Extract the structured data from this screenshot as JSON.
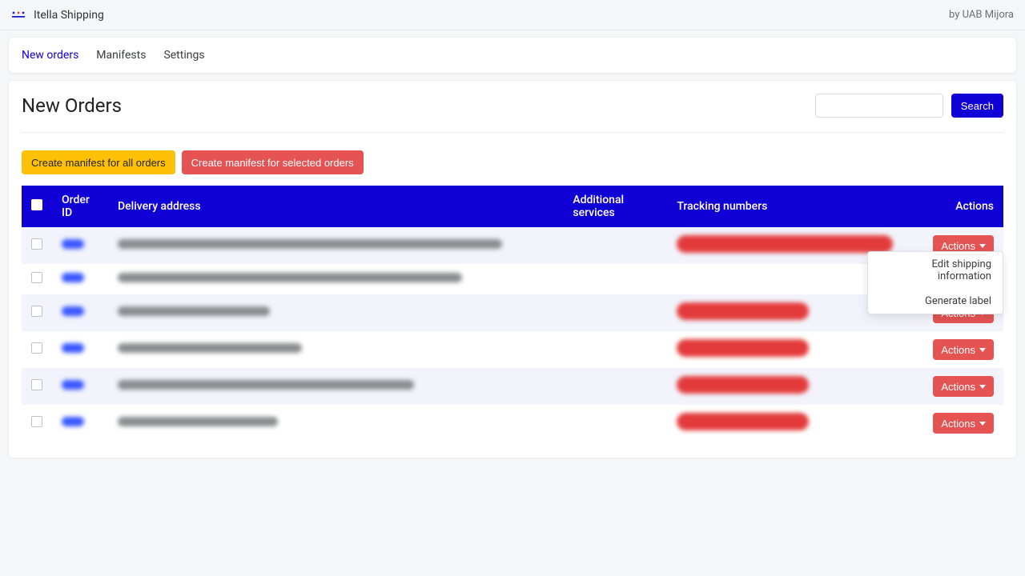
{
  "header": {
    "app_name": "Itella Shipping",
    "byline": "by UAB Mijora"
  },
  "tabs": {
    "new_orders": "New orders",
    "manifests": "Manifests",
    "settings": "Settings"
  },
  "page": {
    "title": "New Orders",
    "search_button": "Search",
    "create_all": "Create manifest for all orders",
    "create_selected": "Create manifest for selected orders"
  },
  "table": {
    "cols": {
      "order_id": "Order ID",
      "delivery_address": "Delivery address",
      "additional_services": "Additional services",
      "tracking_numbers": "Tracking numbers",
      "actions": "Actions"
    },
    "action_label": "Actions",
    "dropdown": {
      "edit": "Edit shipping information",
      "generate": "Generate label"
    }
  }
}
